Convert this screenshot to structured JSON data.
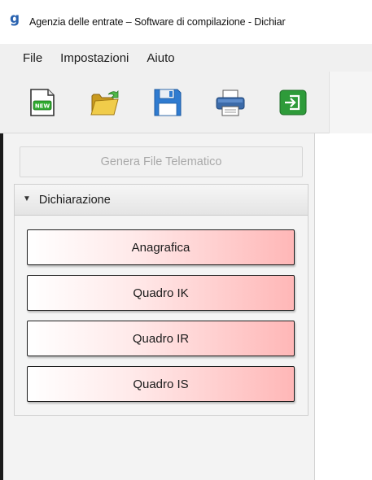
{
  "window": {
    "title": "Agenzia delle entrate – Software di compilazione - Dichiar",
    "app_icon": "g"
  },
  "menu": {
    "items": [
      {
        "label": "File"
      },
      {
        "label": "Impostazioni"
      },
      {
        "label": "Aiuto"
      }
    ]
  },
  "toolbar": {
    "new_badge": "NEW",
    "icons": [
      "new-document-icon",
      "open-folder-icon",
      "save-floppy-icon",
      "print-icon",
      "exit-icon"
    ],
    "colors": {
      "save": "#2f7bd0",
      "print": "#3b6aa8",
      "exit": "#2e9b3a"
    }
  },
  "sidebar": {
    "genera_label": "Genera File Telematico",
    "section": {
      "title": "Dichiarazione",
      "arrow": "▼",
      "buttons": [
        {
          "label": "Anagrafica"
        },
        {
          "label": "Quadro IK"
        },
        {
          "label": "Quadro IR"
        },
        {
          "label": "Quadro IS"
        }
      ]
    }
  }
}
